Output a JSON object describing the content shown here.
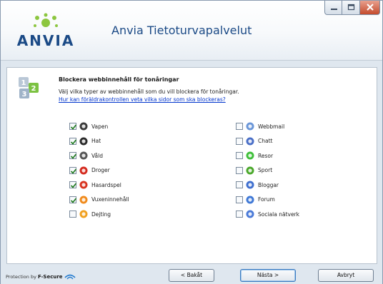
{
  "window": {
    "app_title": "Anvia Tietoturvapalvelut",
    "logo_text": "ANVIA"
  },
  "page": {
    "heading": "Blockera webbinnehåll för tonåringar",
    "description": "Välj vilka typer av webbinnehåll som du vill blockera för tonåringar.",
    "help_link": "Hur kan föräldrakontrollen veta vilka sidor som ska blockeras?"
  },
  "categories_left": [
    {
      "label": "Vapen",
      "checked": true,
      "icon": "gun-icon",
      "color": "#3a3a3a"
    },
    {
      "label": "Hat",
      "checked": true,
      "icon": "hate-icon",
      "color": "#2a2a2a"
    },
    {
      "label": "Våld",
      "checked": true,
      "icon": "violence-icon",
      "color": "#555555"
    },
    {
      "label": "Droger",
      "checked": true,
      "icon": "drugs-icon",
      "color": "#d42a1e"
    },
    {
      "label": "Hasardspel",
      "checked": true,
      "icon": "gambling-icon",
      "color": "#d8331f"
    },
    {
      "label": "Vuxeninnehåll",
      "checked": true,
      "icon": "adult-content-icon",
      "color": "#f08a1c"
    },
    {
      "label": "Dejting",
      "checked": false,
      "icon": "dating-icon",
      "color": "#f0a020"
    }
  ],
  "categories_right": [
    {
      "label": "Webbmail",
      "checked": false,
      "icon": "webmail-icon",
      "color": "#6a96d8"
    },
    {
      "label": "Chatt",
      "checked": false,
      "icon": "chat-icon",
      "color": "#4a6fc7"
    },
    {
      "label": "Resor",
      "checked": false,
      "icon": "travel-icon",
      "color": "#3fbf3a"
    },
    {
      "label": "Sport",
      "checked": false,
      "icon": "sport-icon",
      "color": "#4aa82a"
    },
    {
      "label": "Bloggar",
      "checked": false,
      "icon": "blogs-icon",
      "color": "#3f6fcf"
    },
    {
      "label": "Forum",
      "checked": false,
      "icon": "forum-icon",
      "color": "#3f78d6"
    },
    {
      "label": "Sociala nätverk",
      "checked": false,
      "icon": "social-networks-icon",
      "color": "#4a7ad8"
    }
  ],
  "footer": {
    "protection_label": "Protection by",
    "protection_brand": "F-Secure",
    "back_label": "< Bakåt",
    "next_label": "Nästa >",
    "cancel_label": "Avbryt"
  },
  "colors": {
    "brand_blue": "#1b4a86",
    "link_blue": "#0033cc",
    "brand_green": "#8cc63f"
  }
}
